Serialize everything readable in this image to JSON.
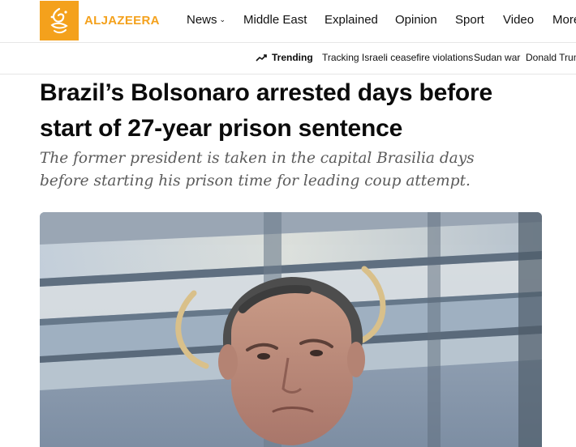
{
  "brand": {
    "name": "ALJAZEERA",
    "logo_icon": "aljazeera-calligraphy-logo",
    "accent_color": "#f4a11c"
  },
  "nav": {
    "items": [
      {
        "label": "News",
        "has_dropdown": true
      },
      {
        "label": "Middle East"
      },
      {
        "label": "Explained"
      },
      {
        "label": "Opinion"
      },
      {
        "label": "Sport"
      },
      {
        "label": "Video"
      },
      {
        "label": "More"
      }
    ]
  },
  "trending": {
    "label": "Trending",
    "icon": "trending-up-icon",
    "links": [
      "Tracking Israeli ceasefire violations",
      "Sudan war",
      "Donald Trump"
    ]
  },
  "article": {
    "headline": "Brazil’s Bolsonaro arrested days before start of 27-year prison sentence",
    "subheadline": "The former president is taken in the capital Brasilia days before starting his prison time for leading coup attempt.",
    "image_subject": "photo of Jair Bolsonaro under a glass canopy"
  }
}
